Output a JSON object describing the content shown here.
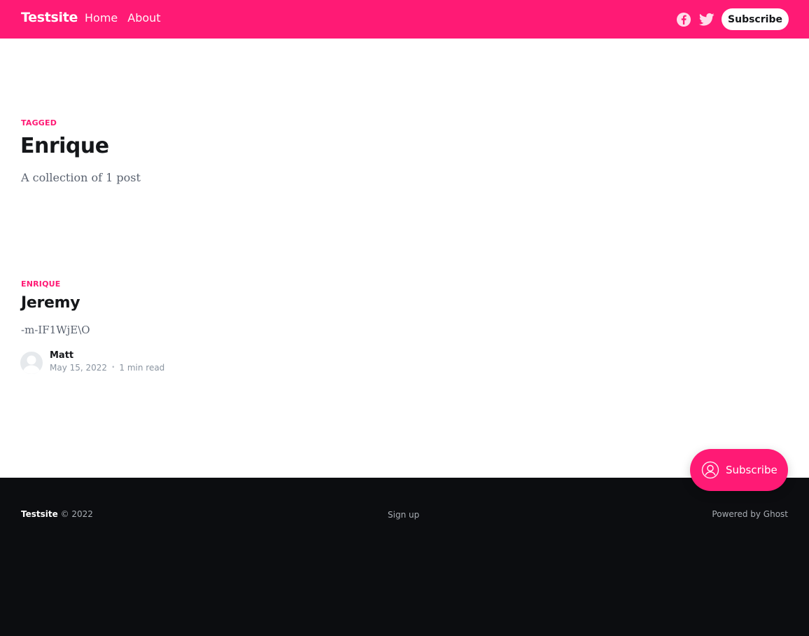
{
  "header": {
    "brand": "Testsite",
    "nav": [
      {
        "label": "Home"
      },
      {
        "label": "About"
      }
    ],
    "social": [
      {
        "icon": "facebook-icon"
      },
      {
        "icon": "twitter-icon"
      }
    ],
    "subscribe_label": "Subscribe",
    "background_color": "#ff1a75"
  },
  "tag_header": {
    "label": "TAGGED",
    "title": "Enrique",
    "description": "A collection of 1 post"
  },
  "posts": [
    {
      "tag": "ENRIQUE",
      "title": "Jeremy",
      "excerpt": "-m-IF1WjE\\O",
      "author": "Matt",
      "date": "May 15, 2022",
      "separator": "•",
      "read_time": "1 min read"
    }
  ],
  "portal": {
    "label": "Subscribe",
    "icon": "user-circle-icon"
  },
  "footer": {
    "brand": "Testsite",
    "copyright": "© 2022",
    "center_link": "Sign up",
    "powered_by": "Powered by Ghost",
    "background_color": "#0c0d10"
  },
  "colors": {
    "accent": "#ff1a75",
    "text": "#15171a",
    "muted": "#5b6370"
  }
}
